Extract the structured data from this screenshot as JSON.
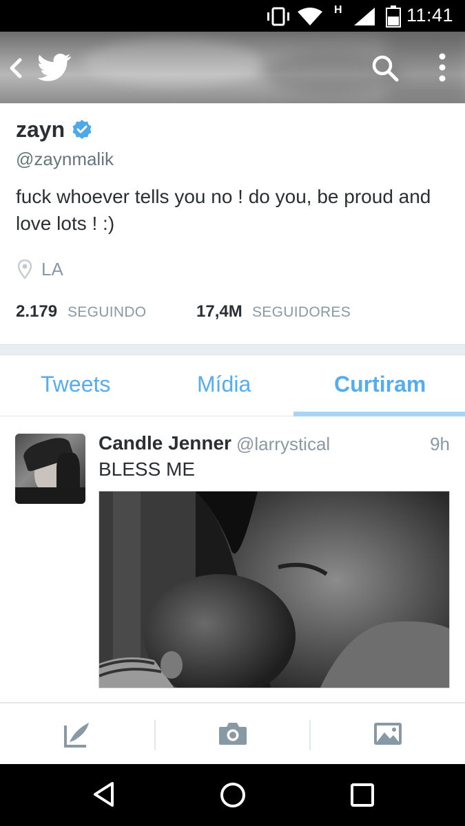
{
  "status_bar": {
    "time": "11:41",
    "network_label": "H",
    "icons": [
      "vibrate-icon",
      "wifi-icon",
      "signal-icon",
      "battery-icon"
    ]
  },
  "header": {
    "icons": [
      "back-icon",
      "twitter-bird-icon",
      "search-icon",
      "overflow-menu-icon"
    ]
  },
  "profile": {
    "name": "zayn",
    "handle": "@zaynmalik",
    "bio": "fuck whoever tells you no ! do you, be proud and love lots ! :)",
    "location": "LA",
    "following_count": "2.179",
    "following_label": "SEGUINDO",
    "followers_count": "17,4M",
    "followers_label": "SEGUIDORES",
    "verified_color": "#4ea9e8"
  },
  "tabs": [
    {
      "label": "Tweets",
      "active": false
    },
    {
      "label": "Mídia",
      "active": false
    },
    {
      "label": "Curtiram",
      "active": true
    }
  ],
  "tweet": {
    "author_name": "Candle Jenner",
    "author_handle": "@larrystical",
    "time": "9h",
    "text": "BLESS ME"
  },
  "toolbar": {
    "icons": [
      "compose-icon",
      "camera-icon",
      "gallery-icon"
    ]
  },
  "navbar": {
    "icons": [
      "nav-back-icon",
      "nav-home-icon",
      "nav-recents-icon"
    ]
  },
  "colors": {
    "accent": "#55acee",
    "text": "#292f33",
    "secondary": "#8899a6"
  }
}
